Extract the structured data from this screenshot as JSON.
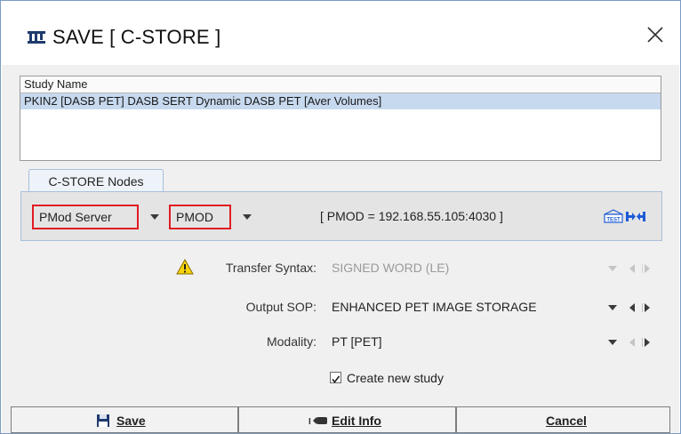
{
  "window": {
    "title": "SAVE [ C-STORE ]",
    "app_icon": "pmod-logo-icon",
    "close_icon": "close-icon"
  },
  "study_list": {
    "header": "Study Name",
    "rows": [
      "PKIN2 [DASB PET] DASB SERT Dynamic DASB PET [Aver Volumes]"
    ]
  },
  "tabs": [
    {
      "label": "C-STORE Nodes"
    }
  ],
  "nodes": {
    "server": "PMod Server",
    "node": "PMOD",
    "address": "[ PMOD = 192.168.55.105:4030 ]",
    "test_icon": "test-connection-icon"
  },
  "fields": {
    "transfer_syntax": {
      "label": "Transfer Syntax:",
      "value": "SIGNED  WORD (LE)",
      "enabled": false,
      "warning_icon": "warning-icon"
    },
    "output_sop": {
      "label": "Output SOP:",
      "value": "ENHANCED PET IMAGE STORAGE",
      "enabled": true
    },
    "modality": {
      "label": "Modality:",
      "value": "PT [PET]",
      "enabled": true
    }
  },
  "create_new_study": {
    "label": "Create new study",
    "checked": true
  },
  "buttons": {
    "save": {
      "label": "Save",
      "icon": "floppy-disk-icon"
    },
    "edit_info": {
      "label": "Edit Info",
      "icon": "edit-tag-icon"
    },
    "cancel": {
      "label": "Cancel"
    }
  },
  "colors": {
    "highlight_border": "#e11b22",
    "selected_row": "#c7d9ee",
    "accent_blue": "#1e5bd6"
  }
}
